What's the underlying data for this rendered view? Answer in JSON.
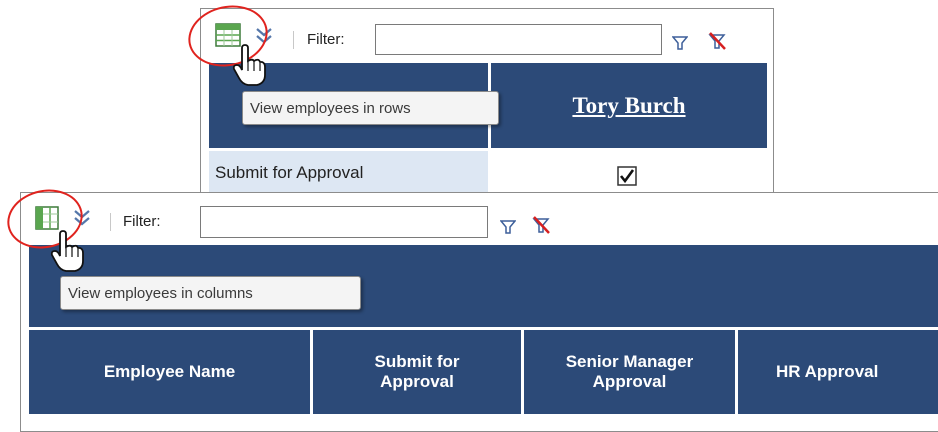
{
  "top_panel": {
    "toolbar": {
      "grid_icon": "grid-view-icon",
      "expand_icon": "double-chevron-down-icon",
      "filter_label": "Filter:",
      "filter_value": "",
      "filter_icon": "funnel-icon",
      "clear_filter_icon": "funnel-clear-icon"
    },
    "tooltip": "View employees in rows",
    "employee_link": "Tory Burch",
    "row_label": "Submit for Approval",
    "row_checked": true
  },
  "bottom_panel": {
    "toolbar": {
      "grid_icon": "grid-view-icon",
      "expand_icon": "double-chevron-down-icon",
      "filter_label": "Filter:",
      "filter_value": "",
      "filter_icon": "funnel-icon",
      "clear_filter_icon": "funnel-clear-icon"
    },
    "tooltip": "View employees in columns",
    "columns": [
      "Employee Name",
      "Submit for Approval",
      "Senior Manager Approval",
      "HR Approval"
    ]
  },
  "colors": {
    "header_navy": "#2c4a78",
    "highlight_circle": "#e0231e",
    "label_cell_bg": "#dde7f3"
  }
}
